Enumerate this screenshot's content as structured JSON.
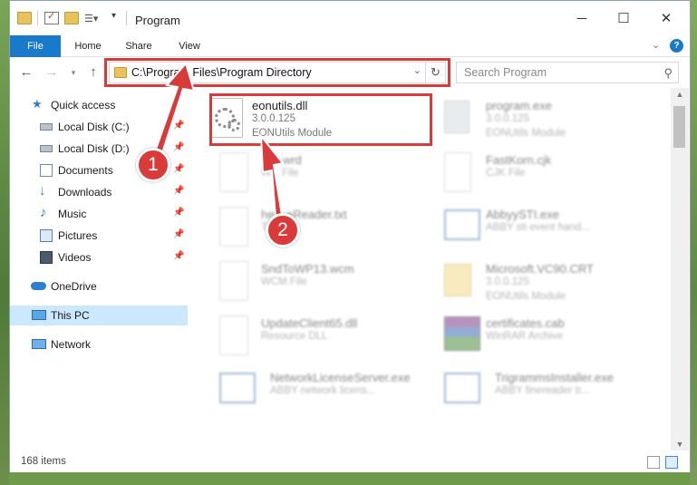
{
  "window": {
    "title": "Program",
    "controls": {
      "minimize": "─",
      "maximize": "☐",
      "close": "✕"
    }
  },
  "ribbon": {
    "tabs": [
      "File",
      "Home",
      "Share",
      "View"
    ],
    "expand_icon": "chevron-down-icon",
    "help_icon": "help-icon"
  },
  "navigation": {
    "back_icon": "←",
    "forward_icon": "→",
    "up_icon": "↑",
    "address": "C:\\Program Files\\Program Directory",
    "search_placeholder": "Search Program"
  },
  "sidebar": {
    "items": [
      {
        "label": "Quick access",
        "icon": "star-icon",
        "pinned": false
      },
      {
        "label": "Local Disk (C:)",
        "icon": "drive-icon",
        "pinned": true
      },
      {
        "label": "Local Disk (D:)",
        "icon": "drive-icon",
        "pinned": true
      },
      {
        "label": "Documents",
        "icon": "documents-icon",
        "pinned": true
      },
      {
        "label": "Downloads",
        "icon": "download-icon",
        "pinned": true
      },
      {
        "label": "Music",
        "icon": "music-icon",
        "pinned": true
      },
      {
        "label": "Pictures",
        "icon": "pictures-icon",
        "pinned": true
      },
      {
        "label": "Videos",
        "icon": "videos-icon",
        "pinned": true
      },
      {
        "label": "OneDrive",
        "icon": "cloud-icon",
        "pinned": false
      },
      {
        "label": "This PC",
        "icon": "computer-icon",
        "pinned": false,
        "selected": true
      },
      {
        "label": "Network",
        "icon": "network-icon",
        "pinned": false
      }
    ]
  },
  "files": [
    {
      "name": "eonutils.dll",
      "line1": "3.0.0.125",
      "line2": "EONUtils Module",
      "highlighted": true
    },
    {
      "name": "program.exe",
      "line1": "3.0.0.125",
      "line2": "EONUtils Module"
    },
    {
      "name": "...ic.wrd",
      "line1": "W... File",
      "line2": ""
    },
    {
      "name": "FastKorn.cjk",
      "line1": "CJK File",
      "line2": ""
    },
    {
      "name": "hel...eReader.txt",
      "line1": "TX...",
      "line2": ""
    },
    {
      "name": "AbbyySTI.exe",
      "line1": "ABBY sti event hand...",
      "line2": ""
    },
    {
      "name": "SndToWP13.wcm",
      "line1": "WCM File",
      "line2": ""
    },
    {
      "name": "Microsoft.VC90.CRT",
      "line1": "3.0.0.125",
      "line2": "EONUtils Module"
    },
    {
      "name": "UpdateClient65.dll",
      "line1": "Resource DLL",
      "line2": ""
    },
    {
      "name": "certificates.cab",
      "line1": "WinRAR Archive",
      "line2": ""
    },
    {
      "name": "NetworkLicenseServer.exe",
      "line1": "ABBY network licens...",
      "line2": ""
    },
    {
      "name": "TrigrammsInstaller.exe",
      "line1": "ABBY finereader tr...",
      "line2": ""
    }
  ],
  "status": {
    "item_count": "168 items"
  },
  "annotations": {
    "badge1": "1",
    "badge2": "2"
  },
  "colors": {
    "accent": "#1979ca",
    "highlight": "#d93a3a",
    "selected": "#cce8ff"
  }
}
